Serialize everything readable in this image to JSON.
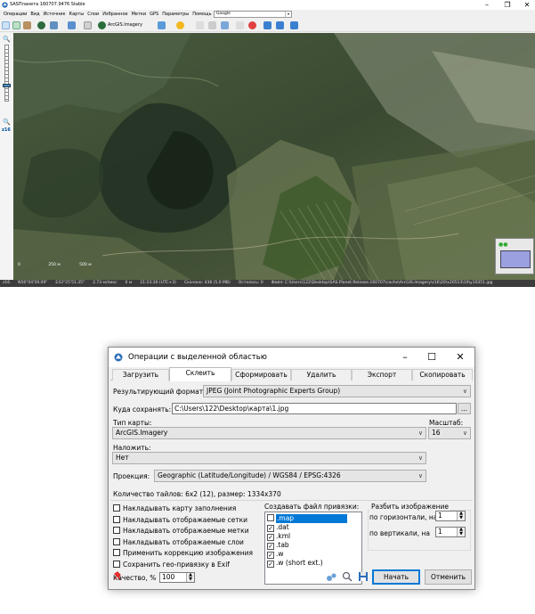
{
  "main_window": {
    "title": "SASПланета 160707.9476 Stable",
    "menu": [
      "Операции",
      "Вид",
      "Источник",
      "Карты",
      "Слои",
      "Избранное",
      "Метки",
      "GPS",
      "Параметры",
      "Помощь"
    ],
    "map_source_combo": "Google",
    "toolbar": {
      "map_label": "ArcGIS.Imagery"
    },
    "zoom_label": "z16",
    "scale_labels": [
      "0",
      "250 м",
      "500 м"
    ],
    "status": [
      "z16",
      "N56°04'59.09\"",
      "E43°25'51.35\"",
      "2.73 м/пикс",
      "0 м",
      "21:23:30 (UTC+3)",
      "Скачано: 438 (5.0 MB)",
      "Осталось: 0",
      "Файл: C:\\Users\\122\\Desktop\\SAS.Planet.Release.160707\\cache\\ArcGIS.Imagery\\z16\\20\\x20513\\10\\y10351.jpg"
    ]
  },
  "dialog": {
    "title": "Операции с выделенной областью",
    "tabs": [
      "Загрузить",
      "Склеить",
      "Сформировать",
      "Удалить",
      "Экспорт",
      "Скопировать"
    ],
    "active_tab": "Склеить",
    "result_format_label": "Результирующий формат:",
    "result_format_value": "JPEG (Joint Photographic Experts Group)",
    "save_to_label": "Куда сохранять:",
    "save_to_value": "C:\\Users\\122\\Desktop\\карта\\1.jpg",
    "browse_label": "...",
    "map_type_label": "Тип карты:",
    "map_type_value": "ArcGIS.Imagery",
    "scale_label": "Масштаб:",
    "scale_value": "16",
    "overlay_label": "Наложить:",
    "overlay_value": "Нет",
    "projection_label": "Проекция:",
    "projection_value": "Geographic (Latitude/Longitude) / WGS84 / EPSG:4326",
    "tiles_info": "Количество тайлов: 6x2 (12), размер: 1334x370",
    "options": [
      {
        "label": "Накладывать карту заполнения",
        "checked": false
      },
      {
        "label": "Накладывать отображаемые сетки",
        "checked": false
      },
      {
        "label": "Накладывать отображаемые метки",
        "checked": false
      },
      {
        "label": "Накладывать отображаемые слои",
        "checked": false
      },
      {
        "label": "Применить коррекцию изображения",
        "checked": false
      },
      {
        "label": "Сохранить гео-привязку в Exif",
        "checked": false
      }
    ],
    "quality_label": "Качество, %",
    "quality_value": "100",
    "binding_label": "Создавать файл привязки:",
    "binding_files": [
      {
        "label": ".map",
        "checked": false,
        "selected": true
      },
      {
        "label": ".dat",
        "checked": true,
        "selected": false
      },
      {
        "label": ".kml",
        "checked": true,
        "selected": false
      },
      {
        "label": ".tab",
        "checked": true,
        "selected": false
      },
      {
        "label": ".w",
        "checked": true,
        "selected": false
      },
      {
        "label": ".w (short ext.)",
        "checked": true,
        "selected": false
      }
    ],
    "split_group_label": "Разбить изображение",
    "split_horizontal_label": "по горизонтали, на",
    "split_horizontal_value": "1",
    "split_vertical_label": "по вертикали, на",
    "split_vertical_value": "1",
    "start_button": "Начать",
    "cancel_button": "Отменить",
    "checkmark": "✓",
    "win_min": "–",
    "win_max": "☐",
    "win_close": "✕"
  }
}
